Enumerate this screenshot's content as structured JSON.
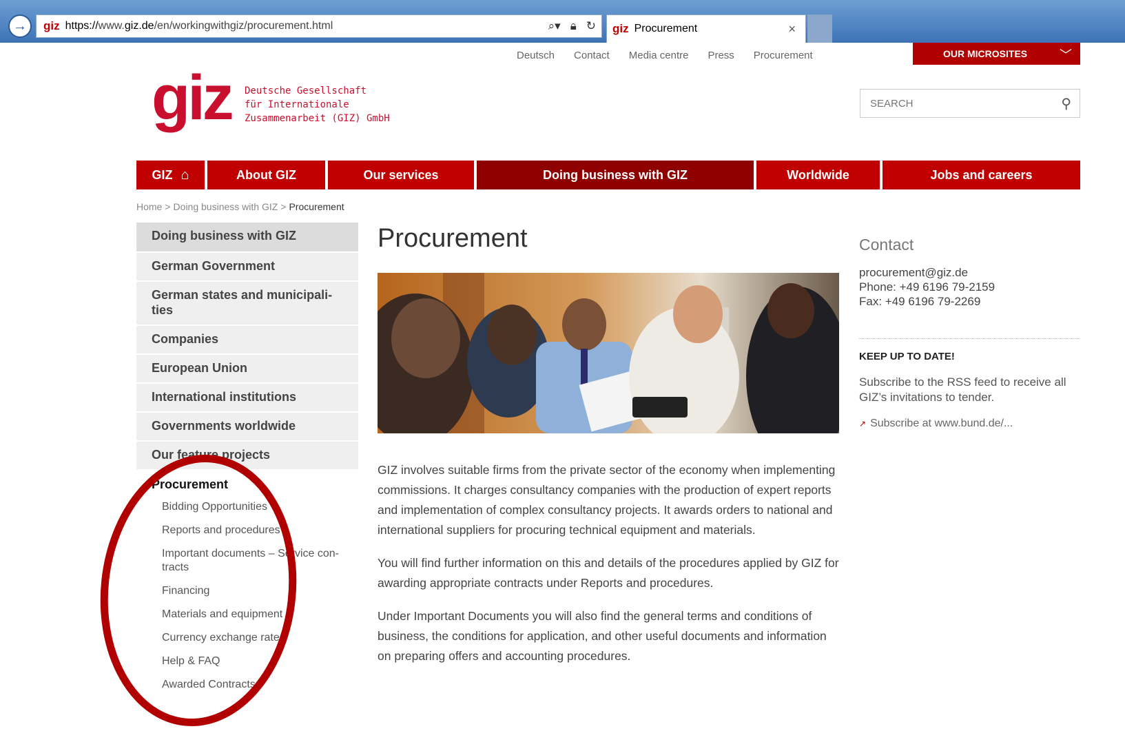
{
  "browser": {
    "favicon_text": "giz",
    "url_prefix": "https://",
    "url_domain_pre": "www.",
    "url_domain": "giz.de",
    "url_path": "/en/workingwithgiz/procurement.html",
    "tab_title": "Procurement",
    "tab_close": "×"
  },
  "toplinks": [
    "Deutsch",
    "Contact",
    "Media centre",
    "Press",
    "Procurement"
  ],
  "microsites": {
    "label": "OUR MICROSITES"
  },
  "logo": {
    "mark": "giz",
    "line1": "Deutsche Gesellschaft",
    "line2": "für Internationale",
    "line3": "Zusammenarbeit (GIZ) GmbH"
  },
  "search": {
    "placeholder": "SEARCH"
  },
  "mainnav": {
    "home": "GIZ",
    "items": [
      "About GIZ",
      "Our services",
      "Doing business with GIZ",
      "Worldwide",
      "Jobs and careers"
    ],
    "active": "Doing business with GIZ"
  },
  "breadcrumb": {
    "home": "Home",
    "sep": ">",
    "parent": "Doing business with GIZ",
    "current": "Procurement"
  },
  "sidebar": {
    "items": [
      "Doing business with GIZ",
      "German Government",
      "German states and municipali-\nties",
      "Companies",
      "European Union",
      "International institutions",
      "Governments worldwide",
      "Our feature projects"
    ],
    "current": "Procurement",
    "subitems": [
      "Bidding Opportunities",
      "Reports and procedures",
      "Important documents – Service con-\ntracts",
      "Financing",
      "Materials and equipment",
      "Currency exchange rates",
      "Help & FAQ",
      "Awarded Contracts"
    ]
  },
  "main": {
    "title": "Procurement",
    "paragraphs": [
      "GIZ involves suitable firms from the private sector of the economy when implementing commissions. It charges consultancy companies with the production of expert reports and implementation of complex consultancy projects. It awards orders to national and international suppliers for procuring technical equipment and materials.",
      "You will find further information on this and details of the procedures applied by GIZ for awarding appropriate contracts under Reports and procedures.",
      "Under Important Documents you will also find the general terms and conditions of business, the conditions for application, and other useful documents and information on preparing offers and accounting procedures."
    ]
  },
  "contact": {
    "heading": "Contact",
    "email": "procurement@giz.de",
    "phone": "Phone: +49 6196 79-2159",
    "fax": "Fax: +49 6196 79-2269"
  },
  "keepup": {
    "heading": "KEEP UP TO DATE!",
    "body": "Subscribe to the RSS feed to receive all GIZ’s invitations to tender.",
    "link": "Subscribe at www.bund.de/..."
  },
  "colors": {
    "brand_red": "#c00000",
    "active_red": "#8e0000",
    "annotation": "#b00000"
  }
}
